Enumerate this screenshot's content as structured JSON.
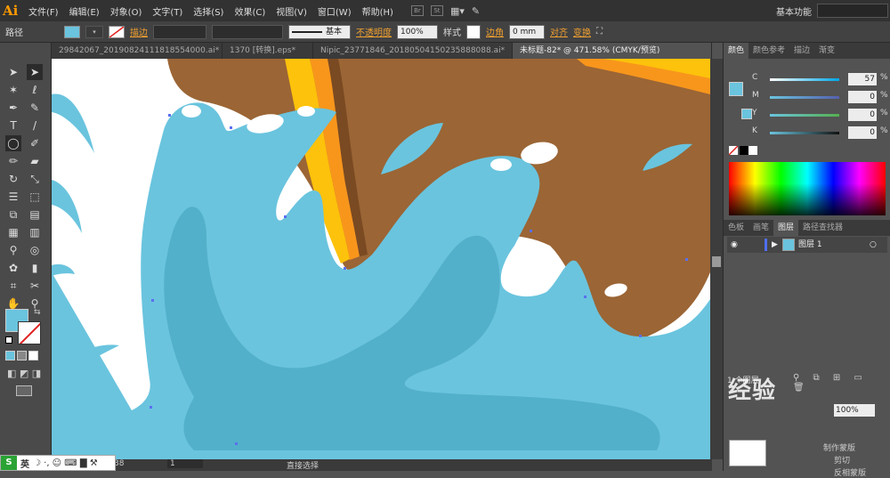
{
  "app": {
    "logo": "Ai",
    "workspace": "基本功能"
  },
  "menu": [
    "文件(F)",
    "编辑(E)",
    "对象(O)",
    "文字(T)",
    "选择(S)",
    "效果(C)",
    "视图(V)",
    "窗口(W)",
    "帮助(H)"
  ],
  "control": {
    "path_label": "路径",
    "stroke_label": "描边",
    "stroke_style": "基本",
    "opacity_label": "不透明度",
    "opacity_value": "100%",
    "style_label": "样式",
    "corner_label": "边角",
    "corner_value": "0 mm",
    "align_label": "对齐",
    "transform_label": "变换"
  },
  "tabs": [
    {
      "label": "29842067_20190824111818554000.ai*"
    },
    {
      "label": "1370 [转换].eps*"
    },
    {
      "label": "Nipic_23771846_20180504150235888088.ai*"
    },
    {
      "label": "未标题-82* @ 471.58% (CMYK/预览)"
    }
  ],
  "color_panel": {
    "tabs": [
      "颜色",
      "颜色参考",
      "描边",
      "渐变"
    ],
    "channels": [
      {
        "name": "C",
        "value": "57",
        "pct": 0.57,
        "color": "#37a6d6"
      },
      {
        "name": "M",
        "value": "0",
        "pct": 0,
        "color": "#d63789"
      },
      {
        "name": "Y",
        "value": "0",
        "pct": 0,
        "color": "#d6d637"
      },
      {
        "name": "K",
        "value": "0",
        "pct": 0,
        "color": "#222222"
      }
    ],
    "unit": "%"
  },
  "layers_panel": {
    "tabs": [
      "色板",
      "画笔",
      "图层",
      "路径查找器"
    ],
    "layer_name": "图层 1",
    "count": "1 个图层"
  },
  "status": {
    "zoom": "38",
    "page": "1",
    "tool": "直接选择"
  },
  "ime": {
    "lang": "英"
  },
  "watermark": "经验",
  "bottom_panel": {
    "opacity": "100%",
    "clip": "剪切",
    "invert": "反相蒙版",
    "make_mask": "制作蒙版"
  },
  "colors": {
    "water": "#6ac4de",
    "water_dark": "#53b0ca",
    "brown": "#9b6535",
    "orange": "#f8961c",
    "yellow": "#fdc20b",
    "white": "#ffffff"
  }
}
